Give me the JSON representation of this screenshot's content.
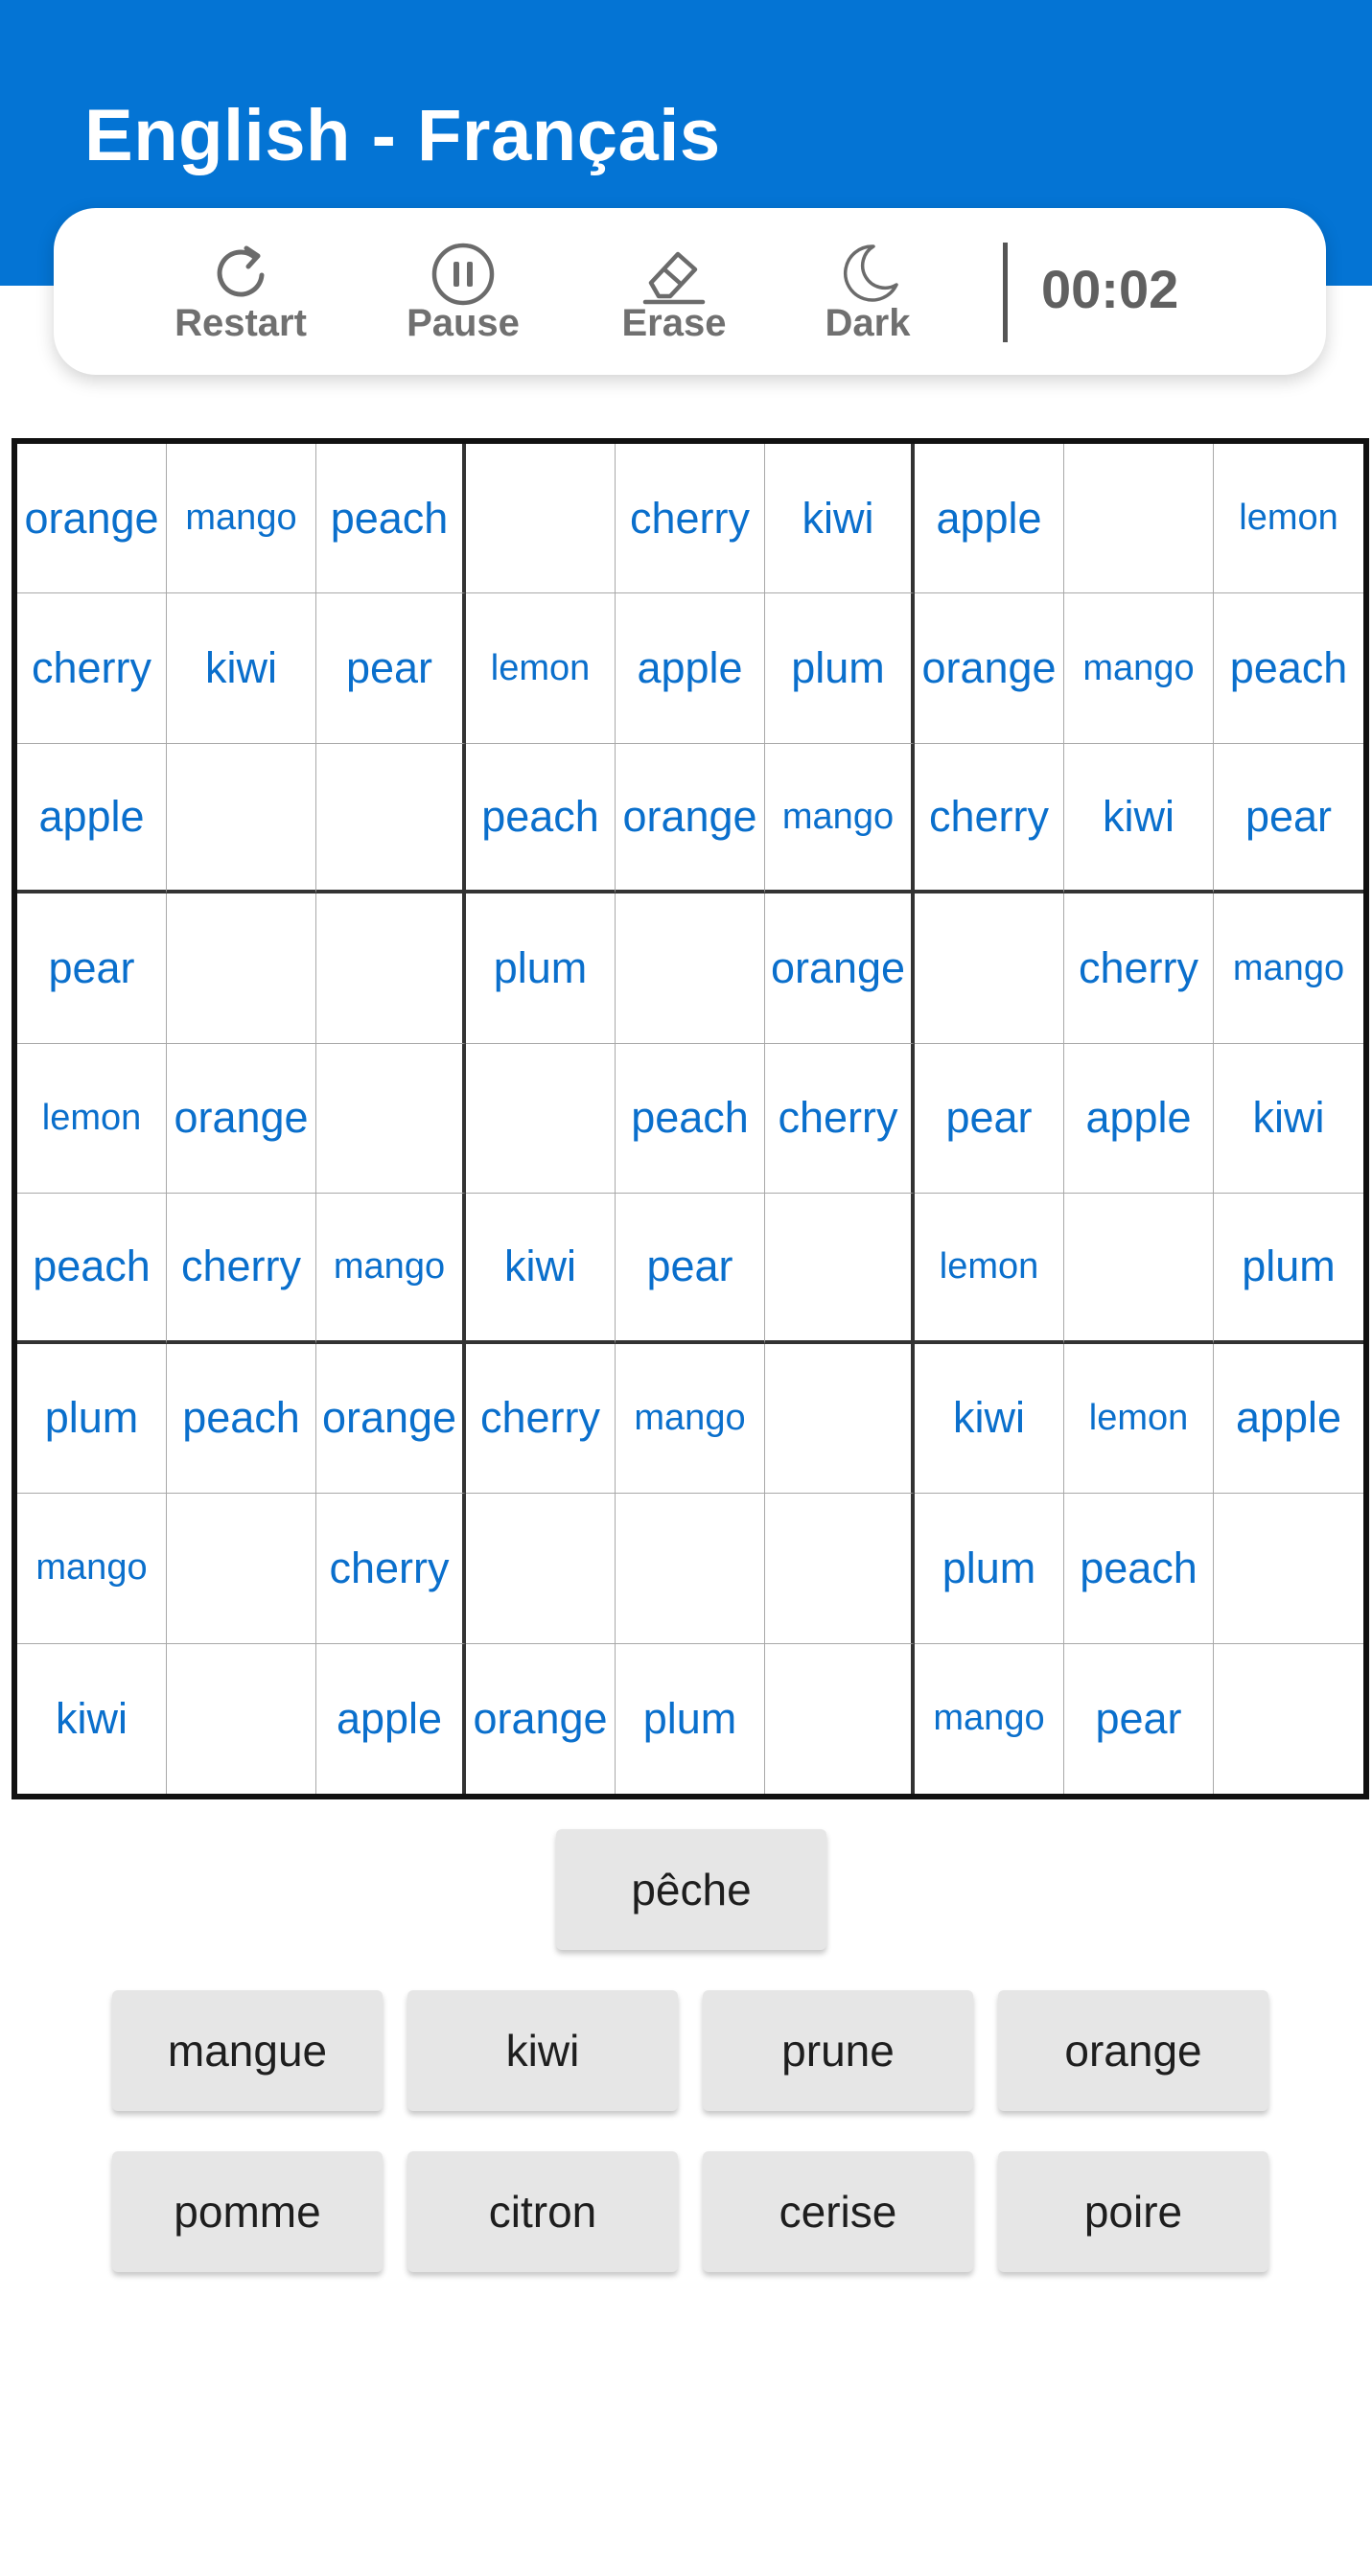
{
  "header": {
    "title": "English - Français",
    "color": "#0474d4"
  },
  "toolbar": {
    "restart": {
      "label": "Restart",
      "icon": "restart-icon"
    },
    "pause": {
      "label": "Pause",
      "icon": "pause-icon"
    },
    "erase": {
      "label": "Erase",
      "icon": "eraser-icon"
    },
    "dark": {
      "label": "Dark",
      "icon": "moon-icon"
    },
    "timer": "00:02"
  },
  "board": {
    "accent_color": "#0a6fcc",
    "rows": [
      [
        "orange",
        "mango",
        "peach",
        "",
        "cherry",
        "kiwi",
        "apple",
        "",
        "lemon"
      ],
      [
        "cherry",
        "kiwi",
        "pear",
        "lemon",
        "apple",
        "plum",
        "orange",
        "mango",
        "peach"
      ],
      [
        "apple",
        "",
        "",
        "peach",
        "orange",
        "mango",
        "cherry",
        "kiwi",
        "pear"
      ],
      [
        "pear",
        "",
        "",
        "plum",
        "",
        "orange",
        "",
        "cherry",
        "mango"
      ],
      [
        "lemon",
        "orange",
        "",
        "",
        "peach",
        "cherry",
        "pear",
        "apple",
        "kiwi"
      ],
      [
        "peach",
        "cherry",
        "mango",
        "kiwi",
        "pear",
        "",
        "lemon",
        "",
        "plum"
      ],
      [
        "plum",
        "peach",
        "orange",
        "cherry",
        "mango",
        "",
        "kiwi",
        "lemon",
        "apple"
      ],
      [
        "mango",
        "",
        "cherry",
        "",
        "",
        "",
        "plum",
        "peach",
        ""
      ],
      [
        "kiwi",
        "",
        "apple",
        "orange",
        "plum",
        "",
        "mango",
        "pear",
        ""
      ]
    ]
  },
  "choices": {
    "top": "pêche",
    "row1": [
      "mangue",
      "kiwi",
      "prune",
      "orange"
    ],
    "row2": [
      "pomme",
      "citron",
      "cerise",
      "poire"
    ]
  }
}
